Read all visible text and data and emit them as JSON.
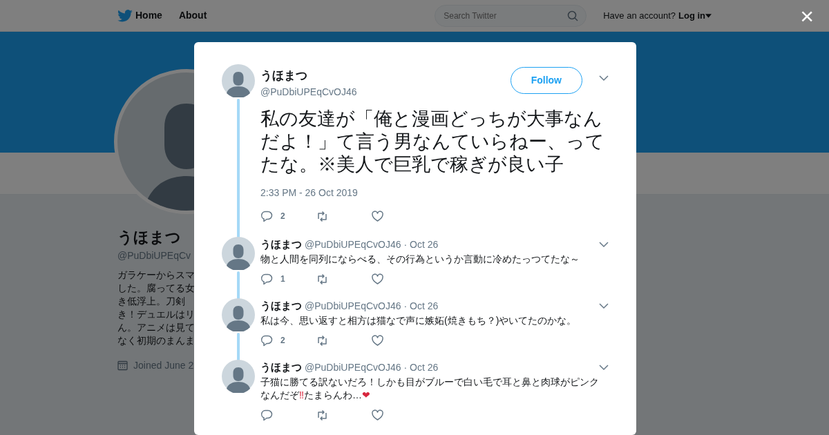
{
  "nav": {
    "home": "Home",
    "about": "About",
    "search_placeholder": "Search Twitter",
    "account_prompt": "Have an account?",
    "login": "Log in"
  },
  "profile": {
    "name": "うほまつ",
    "handle": "@PuDbiUPEqCv",
    "bio_lines": [
      "ガラケーからスマ",
      "した。腐ってる女",
      "き低浮上。刀剣",
      "き！デュエルはリ",
      "ん。アニメは見て",
      "なく初期のまんま"
    ],
    "joined": "Joined June 2"
  },
  "close": "×",
  "tweet": {
    "name": "うほまつ",
    "handle": "@PuDbiUPEqCvOJ46",
    "follow": "Follow",
    "text": "私の友達が「俺と漫画どっちが大事なんだよ！」て言う男なんていらねー、ってたな。※美人で巨乳で稼ぎが良い子",
    "timestamp": "2:33 PM - 26 Oct 2019",
    "reply_count": "2",
    "thread_line": true
  },
  "replies": [
    {
      "name": "うほまつ",
      "handle": "@PuDbiUPEqCvOJ46",
      "date": "· Oct 26",
      "text": "物と人間を同列にならべる、その行為というか言動に冷めたっつてたな～",
      "reply_count": "1",
      "thread_line": true
    },
    {
      "name": "うほまつ",
      "handle": "@PuDbiUPEqCvOJ46",
      "date": "· Oct 26",
      "text": "私は今、思い返すと相方は猫なで声に嫉妬(焼きもち？)やいてたのかな。",
      "reply_count": "2",
      "thread_line": true
    },
    {
      "name": "うほまつ",
      "handle": "@PuDbiUPEqCvOJ46",
      "date": "· Oct 26",
      "text": "子猫に勝てる訳ないだろ！しかも目がブルーで白い毛で耳と鼻と肉球がピンクなんだぞ‼たまらんわ…❤",
      "thread_line": false
    }
  ]
}
